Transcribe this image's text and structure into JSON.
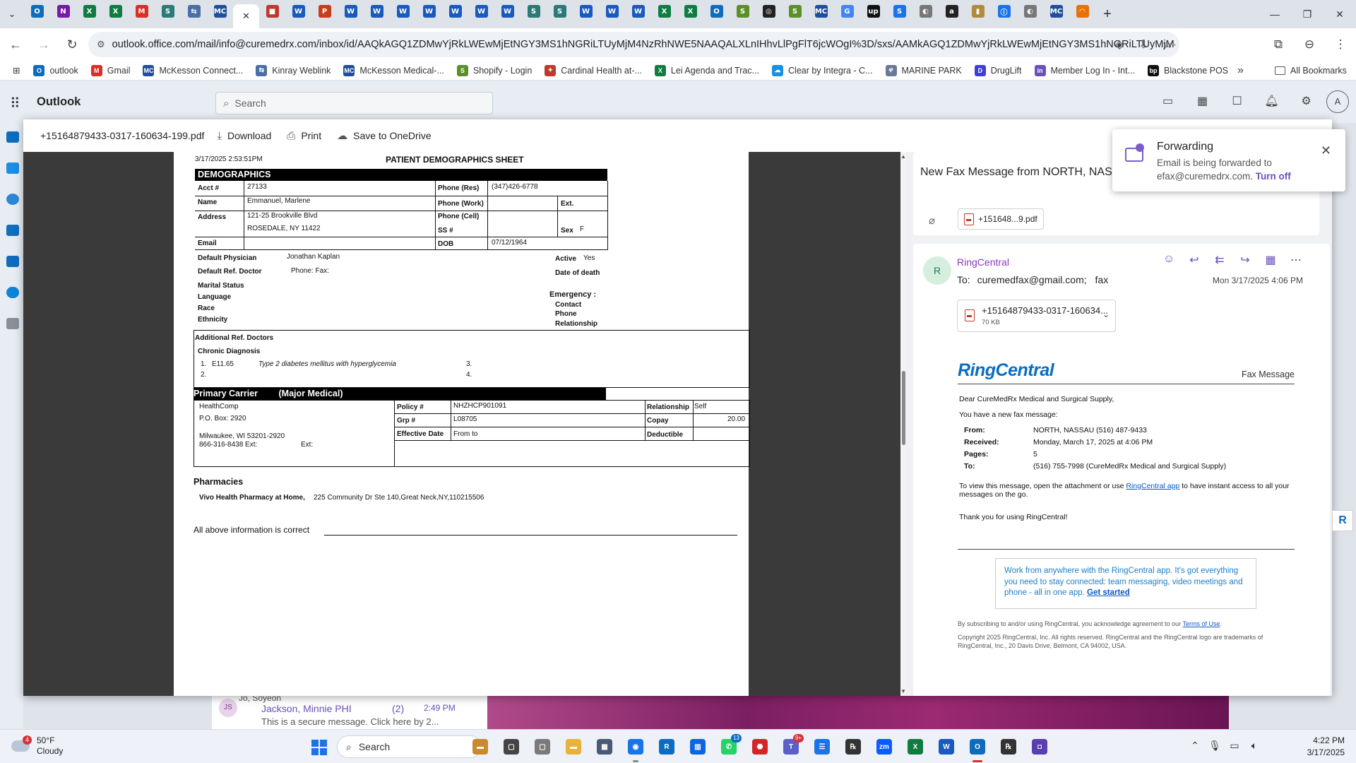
{
  "browser": {
    "tabs": [
      {
        "icon": "O",
        "color": "#0f6cbd",
        "active": false
      },
      {
        "icon": "N",
        "color": "#7719aa",
        "active": false
      },
      {
        "icon": "X",
        "color": "#107c41",
        "active": false
      },
      {
        "icon": "X",
        "color": "#107c41",
        "active": false
      },
      {
        "icon": "M",
        "color": "#d93025",
        "active": false
      },
      {
        "icon": "S",
        "color": "#2b7a78",
        "active": false
      },
      {
        "icon": "⇆",
        "color": "#4a6fa5",
        "active": false
      },
      {
        "icon": "MC",
        "color": "#1f4e9c",
        "active": false
      },
      {
        "icon": "✕",
        "color": "#ffffff",
        "active": true
      },
      {
        "icon": "■",
        "color": "#c0392b",
        "active": false
      },
      {
        "icon": "W",
        "color": "#185abd",
        "active": false
      },
      {
        "icon": "P",
        "color": "#c43e1c",
        "active": false
      },
      {
        "icon": "W",
        "color": "#185abd",
        "active": false
      },
      {
        "icon": "W",
        "color": "#185abd",
        "active": false
      },
      {
        "icon": "W",
        "color": "#185abd",
        "active": false
      },
      {
        "icon": "W",
        "color": "#185abd",
        "active": false
      },
      {
        "icon": "W",
        "color": "#185abd",
        "active": false
      },
      {
        "icon": "W",
        "color": "#185abd",
        "active": false
      },
      {
        "icon": "W",
        "color": "#185abd",
        "active": false
      },
      {
        "icon": "S",
        "color": "#2b7a78",
        "active": false
      },
      {
        "icon": "S",
        "color": "#2b7a78",
        "active": false
      },
      {
        "icon": "W",
        "color": "#185abd",
        "active": false
      },
      {
        "icon": "W",
        "color": "#185abd",
        "active": false
      },
      {
        "icon": "W",
        "color": "#185abd",
        "active": false
      },
      {
        "icon": "X",
        "color": "#107c41",
        "active": false
      },
      {
        "icon": "X",
        "color": "#107c41",
        "active": false
      },
      {
        "icon": "O",
        "color": "#0f6cbd",
        "active": false
      },
      {
        "icon": "S",
        "color": "#5a8f29",
        "active": false
      },
      {
        "icon": "◎",
        "color": "#222222",
        "active": false
      },
      {
        "icon": "S",
        "color": "#5a8f29",
        "active": false
      },
      {
        "icon": "MC",
        "color": "#1f4e9c",
        "active": false
      },
      {
        "icon": "G",
        "color": "#4285f4",
        "active": false
      },
      {
        "icon": "up",
        "color": "#111111",
        "active": false
      },
      {
        "icon": "S",
        "color": "#1a73e8",
        "active": false
      },
      {
        "icon": "◐",
        "color": "#777777",
        "active": false
      },
      {
        "icon": "a",
        "color": "#222222",
        "active": false
      },
      {
        "icon": "▮",
        "color": "#b08a3e",
        "active": false
      },
      {
        "icon": "ⓘ",
        "color": "#1a73e8",
        "active": false
      },
      {
        "icon": "◐",
        "color": "#777777",
        "active": false
      },
      {
        "icon": "MC",
        "color": "#1f4e9c",
        "active": false
      },
      {
        "icon": "◠",
        "color": "#e8710a",
        "active": false
      }
    ],
    "url": "outlook.office.com/mail/info@curemedrx.com/inbox/id/AAQkAGQ1ZDMwYjRkLWEwMjEtNGY3MS1hNGRiLTUyMjM4NzRhNWE5NAAQALXLnIHhvLlPgFlT6jcWOgI%3D/sxs/AAMkAGQ1ZDMwYjRkLWEwMjEtNGY3MS1hNGRiLTUyMjM4NzRhNWE5N...",
    "bookmarks": [
      {
        "label": "outlook",
        "icon": "O",
        "color": "#0f6cbd"
      },
      {
        "label": "Gmail",
        "icon": "M",
        "color": "#d93025"
      },
      {
        "label": "McKesson Connect...",
        "icon": "MC",
        "color": "#1f4e9c"
      },
      {
        "label": "Kinray Weblink",
        "icon": "⇆",
        "color": "#4a6fa5"
      },
      {
        "label": "McKesson Medical-...",
        "icon": "MC",
        "color": "#1f4e9c"
      },
      {
        "label": "Shopify - Login",
        "icon": "S",
        "color": "#5a8f29"
      },
      {
        "label": "Cardinal Health at-...",
        "icon": "✦",
        "color": "#c0392b"
      },
      {
        "label": "Lei Agenda and Trac...",
        "icon": "X",
        "color": "#107c41"
      },
      {
        "label": "Clear by Integra - C...",
        "icon": "☁",
        "color": "#1a8fe3"
      },
      {
        "label": "MARINE PARK",
        "icon": "ዋ",
        "color": "#6b7a99"
      },
      {
        "label": "DrugLift",
        "icon": "D",
        "color": "#3e3ed8"
      },
      {
        "label": "Member Log In - Int...",
        "icon": "in",
        "color": "#6b4fbb"
      },
      {
        "label": "Blackstone POS",
        "icon": "bp",
        "color": "#111111"
      }
    ],
    "all_bookmarks": "All Bookmarks"
  },
  "outlook": {
    "app_name": "Outlook",
    "search_placeholder": "Search",
    "avatar_initial": "A"
  },
  "background": {
    "sender_initials": "JS",
    "sender": "Jo, Soyeon",
    "name2": "Jackson, Minnie PHI",
    "count": "(2)",
    "time": "2:49 PM",
    "preview": "This is a secure message. Click here by 2..."
  },
  "preview": {
    "filename": "+15164879433-0317-160634-199.pdf",
    "download": "Download",
    "print": "Print",
    "save": "Save to OneDrive"
  },
  "fax_doc": {
    "timestamp": "3/17/2025  2:53:51PM",
    "title": "PATIENT DEMOGRAPHICS SHEET",
    "section": "DEMOGRAPHICS",
    "acct_label": "Acct #",
    "acct": "27133",
    "name_label": "Name",
    "name": "Emmanuel, Marlene",
    "address_label": "Address",
    "address1": "121-25 Brookville Blvd",
    "address2": "ROSEDALE, NY 11422",
    "email_label": "Email",
    "phone_res_label": "Phone (Res)",
    "phone_res": "(347)426-6778",
    "phone_work_label": "Phone (Work)",
    "ext_label": "Ext.",
    "phone_cell_label": "Phone (Cell)",
    "ss_label": "SS #",
    "sex_label": "Sex",
    "sex": "F",
    "dob_label": "DOB",
    "dob": "07/12/1964",
    "physician_label": "Default Physician",
    "physician": "Jonathan Kaplan",
    "ref_doctor_label": "Default Ref. Doctor",
    "ref_phone": "Phone:   Fax:",
    "active_label": "Active",
    "active": "Yes",
    "death_label": "Date of death",
    "marital_label": "Marital Status",
    "language_label": "Language",
    "race_label": "Race",
    "ethnicity_label": "Ethnicity",
    "emergency_label": "Emergency :",
    "contact_label": "Contact",
    "phone_label": "Phone",
    "relationship_label": "Relationship",
    "add_ref_label": "Additional Ref. Doctors",
    "chronic_label": "Chronic Diagnosis",
    "dx1_num": "1.",
    "dx1_code": "E11.65",
    "dx1_desc": "Type 2 diabetes mellitus with hyperglycemia",
    "dx2_num": "2.",
    "dx3_num": "3.",
    "dx4_num": "4.",
    "carrier_label": "Primary Carrier",
    "carrier_type": "(Major Medical)",
    "carrier_name": "HealthComp",
    "carrier_po": "P.O. Box: 2920",
    "carrier_city": "Milwaukee, WI 53201-2920",
    "carrier_phone": "866-316-8438 Ext:",
    "carrier_ext": "Ext:",
    "policy_label": "Policy #",
    "policy": "NHZHCP901091",
    "grp_label": "Grp #",
    "grp": "L08705",
    "eff_label": "Effective Date",
    "eff": "From  to",
    "rel_label": "Relationship",
    "rel": "Self",
    "copay_label": "Copay",
    "copay": "20.00",
    "deductible_label": "Deductible",
    "pharm_label": "Pharmacies",
    "pharm_name": "Vivo Health Pharmacy at Home,",
    "pharm_addr": "225 Community Dr Ste 140,Great Neck,NY,110215506",
    "confirm": "All above information is correct"
  },
  "message": {
    "subject": "New Fax Message from NORTH, NASSAU (516) 487-9433 4:06 PM",
    "attachment_chip": "+151648...9.pdf",
    "sender_initial": "R",
    "sender": "RingCentral",
    "to_label": "To:",
    "to": "curemedfax@gmail.com;",
    "to2": "fax",
    "date": "Mon 3/17/2025 4:06 PM",
    "att_name": "+15164879433-0317-160634...",
    "att_size": "70 KB",
    "logo_a": "Ring",
    "logo_b": "Central",
    "fax_message": "Fax Message",
    "greeting": "Dear CureMedRx Medical and Surgical Supply,",
    "intro": "You have a new fax message:",
    "from_label": "From:",
    "from": "NORTH, NASSAU (516) 487-9433",
    "received_label": "Received:",
    "received": "Monday, March 17, 2025 at 4:06 PM",
    "pages_label": "Pages:",
    "pages": "5",
    "to_fax_label": "To:",
    "to_fax": "(516) 755-7998 (CureMedRx Medical and Surgical Supply)",
    "view_pre": "To view this message, open the attachment or use ",
    "view_link": "RingCentral app",
    "view_post": " to have instant access to all your",
    "view_post2": "messages on the go.",
    "thanks": "Thank you for using RingCentral!",
    "promo": "Work from anywhere with the RingCentral app. It's got everything you need to stay connected: team messaging, video meetings and phone - all in one app. ",
    "promo_link": "Get started",
    "terms_pre": "By subscribing to and/or using RingCentral, you acknowledge agreement to our ",
    "terms_link": "Terms of Use",
    "terms_post": ".",
    "copyright": "Copyright 2025 RingCentral, Inc. All rights reserved. RingCentral and the RingCentral logo are trademarks of RingCentral, Inc., 20 Davis Drive, Belmont, CA 94002, USA."
  },
  "toast": {
    "title": "Forwarding",
    "text": "Email is being forwarded to efax@curemedrx.com.",
    "action": "Turn off"
  },
  "taskbar": {
    "weather_badge": "4",
    "temp": "50°F",
    "condition": "Cloudy",
    "search": "Search",
    "apps": [
      {
        "name": "files-app",
        "icon": "▬",
        "color": "#c98a2e",
        "badge": ""
      },
      {
        "name": "snip-app",
        "icon": "▢",
        "color": "#444444",
        "badge": ""
      },
      {
        "name": "app-gray",
        "icon": "▢",
        "color": "#7a7a7a",
        "badge": ""
      },
      {
        "name": "explorer",
        "icon": "▬",
        "color": "#e8b33a",
        "badge": ""
      },
      {
        "name": "calculator",
        "icon": "▦",
        "color": "#4a5a74",
        "badge": ""
      },
      {
        "name": "chrome",
        "icon": "◉",
        "color": "#1a73e8",
        "badge": ""
      },
      {
        "name": "rx-app",
        "icon": "R",
        "color": "#0a6dc2",
        "badge": ""
      },
      {
        "name": "trello",
        "icon": "▥",
        "color": "#0c66e4",
        "badge": ""
      },
      {
        "name": "whatsapp",
        "icon": "✆",
        "color": "#25d366",
        "badge": "13"
      },
      {
        "name": "acrobat",
        "icon": "⬣",
        "color": "#d4252b",
        "badge": ""
      },
      {
        "name": "teams",
        "icon": "T",
        "color": "#5b5fc7",
        "badge": "9+"
      },
      {
        "name": "notes",
        "icon": "☰",
        "color": "#1a73e8",
        "badge": ""
      },
      {
        "name": "rx-pos",
        "icon": "℞",
        "color": "#333333",
        "badge": ""
      },
      {
        "name": "zoom",
        "icon": "zm",
        "color": "#0b5cff",
        "badge": ""
      },
      {
        "name": "excel",
        "icon": "X",
        "color": "#107c41",
        "badge": ""
      },
      {
        "name": "word",
        "icon": "W",
        "color": "#185abd",
        "badge": ""
      },
      {
        "name": "outlook",
        "icon": "O",
        "color": "#0f6cbd",
        "badge": ""
      },
      {
        "name": "rx-pos-2",
        "icon": "℞",
        "color": "#333333",
        "badge": ""
      },
      {
        "name": "onenote-like",
        "icon": "◘",
        "color": "#5b3fb0",
        "badge": ""
      }
    ],
    "time": "4:22 PM",
    "date": "3/17/2025"
  }
}
